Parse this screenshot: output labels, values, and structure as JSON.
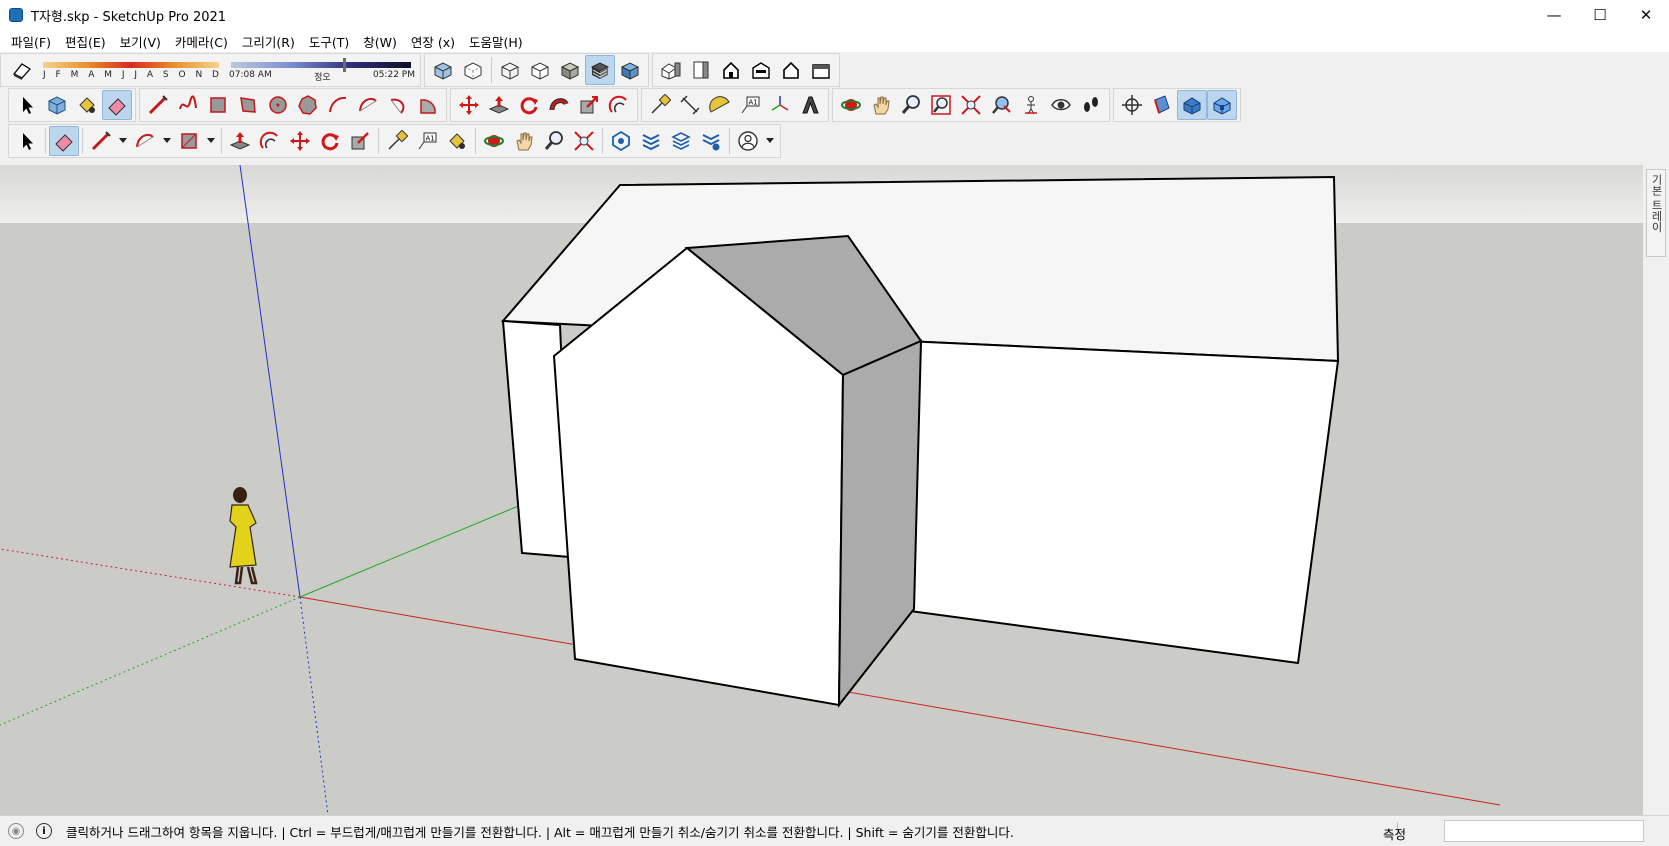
{
  "window": {
    "title": "T자형.skp - SketchUp Pro 2021",
    "minimize_glyph": "—",
    "maximize_glyph": "☐",
    "close_glyph": "✕"
  },
  "menu": [
    "파일(F)",
    "편집(E)",
    "보기(V)",
    "카메라(C)",
    "그리기(R)",
    "도구(T)",
    "창(W)",
    "연장 (x)",
    "도움말(H)"
  ],
  "shadow": {
    "months": [
      "J",
      "F",
      "M",
      "A",
      "M",
      "J",
      "J",
      "A",
      "S",
      "O",
      "N",
      "D"
    ],
    "time_start": "07:08 AM",
    "time_noon": "정오",
    "time_end": "05:22 PM"
  },
  "toolbar_icons": {
    "row1": [
      "styles-xray-icon",
      "styles-backedges-icon",
      "wireframe-icon",
      "hidden-line-icon",
      "shaded-icon",
      "shaded-textures-icon",
      "monochrome-icon",
      "view-iso-icon",
      "view-top-icon",
      "view-front-icon",
      "view-right-icon",
      "view-back-icon",
      "view-left-icon"
    ],
    "row2": [
      "select-icon",
      "make-component-icon",
      "paint-bucket-icon",
      "eraser-icon",
      "line-icon",
      "freehand-icon",
      "rectangle-icon",
      "rotated-rectangle-icon",
      "circle-icon",
      "polygon-icon",
      "arc-icon",
      "two-point-arc-icon",
      "three-point-arc-icon",
      "pie-icon",
      "move-icon",
      "push-pull-icon",
      "rotate-icon",
      "follow-me-icon",
      "scale-icon",
      "offset-icon",
      "tape-measure-icon",
      "dimension-icon",
      "protractor-icon",
      "text-icon",
      "axes-icon",
      "3d-text-icon",
      "orbit-icon",
      "pan-icon",
      "zoom-icon",
      "zoom-window-icon",
      "zoom-extents-icon",
      "previous-view-icon",
      "position-camera-icon",
      "look-around-icon",
      "walk-icon",
      "section-plane-icon",
      "display-section-planes-icon",
      "display-section-cuts-icon",
      "display-section-fill-icon"
    ],
    "row3": [
      "select-icon",
      "eraser-icon",
      "line-icon",
      "arc-icon",
      "rectangle-icon",
      "push-pull-icon",
      "offset-icon",
      "move-icon",
      "rotate-icon",
      "scale-icon",
      "tape-measure-icon",
      "text-icon",
      "paint-bucket-icon",
      "orbit-icon",
      "pan-icon",
      "zoom-icon",
      "zoom-extents-icon",
      "3d-warehouse-icon",
      "extension-warehouse-icon",
      "layout-icon",
      "extension-manager-icon",
      "account-icon"
    ]
  },
  "tray": {
    "label": "기본 트레이"
  },
  "status": {
    "message": "클릭하거나 드래그하여 항목을 지웁니다. | Ctrl = 부드럽게/매끄럽게 만들기를 전환합니다. | Alt = 매끄럽게 만들기 취소/숨기기 취소를 전환합니다. | Shift = 숨기기를 전환합니다.",
    "measure_label": "측정",
    "measure_value": ""
  },
  "colors": {
    "sky": "#e3e3e1",
    "ground": "#cbcbc7",
    "face_light": "#ffffff",
    "face_top": "#f6f6f6",
    "face_dark": "#ababab",
    "axis_red": "#cc2222",
    "axis_green": "#22aa22",
    "axis_blue": "#2233cc"
  }
}
